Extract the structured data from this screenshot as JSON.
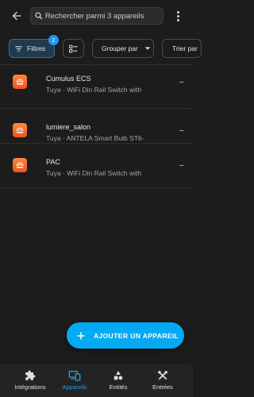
{
  "header": {
    "search_placeholder": "Rechercher parmi 3 appareils"
  },
  "filters": {
    "filters_label": "Filtres",
    "filters_count": "2",
    "group_label": "Grouper par",
    "sort_label": "Trier par"
  },
  "devices": [
    {
      "name": "Cumulus ECS",
      "subtitle": "Tuya · WiFi Din Rail Switch with",
      "value": "–"
    },
    {
      "name": "lumiere_salon",
      "subtitle": "Tuya · ANTELA Smart Bulb ST6-",
      "value": "–"
    },
    {
      "name": "PAC",
      "subtitle": "Tuya · WiFi Din Rail Switch with",
      "value": "–"
    }
  ],
  "fab": {
    "label": "AJOUTER UN APPAREIL"
  },
  "nav": {
    "items": [
      {
        "label": "Intégrations",
        "icon": "puzzle-icon"
      },
      {
        "label": "Appareils",
        "icon": "devices-icon",
        "active": true
      },
      {
        "label": "Entités",
        "icon": "shapes-icon"
      },
      {
        "label": "Entrées",
        "icon": "tools-icon"
      }
    ]
  },
  "colors": {
    "accent": "#03a9f4",
    "background": "#1c1c1c",
    "active_nav": "#2f9ae0",
    "tuya_icon": "#f4511e"
  }
}
